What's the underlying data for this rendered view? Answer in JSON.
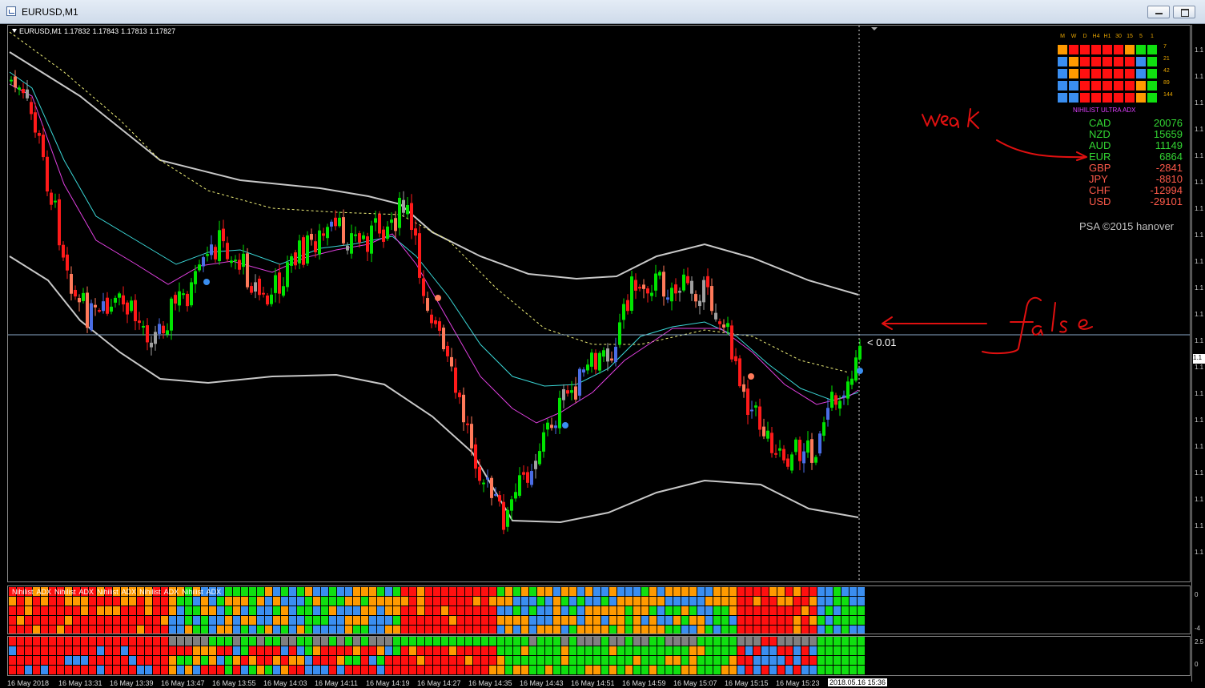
{
  "window": {
    "title": "EURUSD,M1"
  },
  "chart": {
    "header": [
      "EURUSD,M1",
      "1.17832",
      "1.17843",
      "1.17813",
      "1.17827"
    ],
    "price_readout": "< 0.01",
    "credit": "PSA ©2015 hanover"
  },
  "price_axis": {
    "ticks": [
      "1.1",
      "1.1",
      "1.1",
      "1.1",
      "1.1",
      "1.1",
      "1.1",
      "1.1",
      "1.1",
      "1.1",
      "1.1",
      "1.1",
      "1.1",
      "1.1",
      "1.1",
      "1.1",
      "1.1",
      "1.1",
      "1.1",
      "1.1"
    ],
    "current": "1.1"
  },
  "matrix": {
    "timeframes": [
      "M",
      "W",
      "D",
      "H4",
      "H1",
      "30",
      "15",
      "5",
      "1"
    ],
    "periods": [
      "7",
      "21",
      "42",
      "89",
      "144"
    ],
    "title": "NIHILIST ULTRA ADX"
  },
  "strength": [
    {
      "currency": "CAD",
      "value": "20076"
    },
    {
      "currency": "NZD",
      "value": "15659"
    },
    {
      "currency": "AUD",
      "value": "11149"
    },
    {
      "currency": "EUR",
      "value": "6864"
    },
    {
      "currency": "GBP",
      "value": "-2841"
    },
    {
      "currency": "JPY",
      "value": "-8810"
    },
    {
      "currency": "CHF",
      "value": "-12994"
    },
    {
      "currency": "USD",
      "value": "-29101"
    }
  ],
  "colors": {
    "bull": "#00e400",
    "bear": "#ff1a1a",
    "bull_weak": "#4a6de6",
    "bear_weak": "#ff7a5a",
    "neutral": "#a0a0a0",
    "positive_text": "#33d633",
    "negative_text": "#ff5a4a",
    "orange": "#ff9a00",
    "blue": "#3a8ef0",
    "annotation": "#e01010"
  },
  "subwindow1": {
    "label": [
      "Nihilist",
      "ADX",
      "Nihilist",
      "ADX",
      "Nihilist",
      "ADX",
      "Nihilist",
      "ADX",
      "Nihilist",
      "ADX"
    ],
    "axis": [
      "0",
      "-4"
    ]
  },
  "subwindow2": {
    "axis": [
      "2.5",
      "0"
    ]
  },
  "time_axis": {
    "labels": [
      "16 May 2018",
      "16 May 13:31",
      "16 May 13:39",
      "16 May 13:47",
      "16 May 13:55",
      "16 May 14:03",
      "16 May 14:11",
      "16 May 14:19",
      "16 May 14:27",
      "16 May 14:35",
      "16 May 14:43",
      "16 May 14:51",
      "16 May 14:59",
      "16 May 15:07",
      "16 May 15:15",
      "16 May 15:23"
    ],
    "current": "2018.05.16 15:36"
  }
}
